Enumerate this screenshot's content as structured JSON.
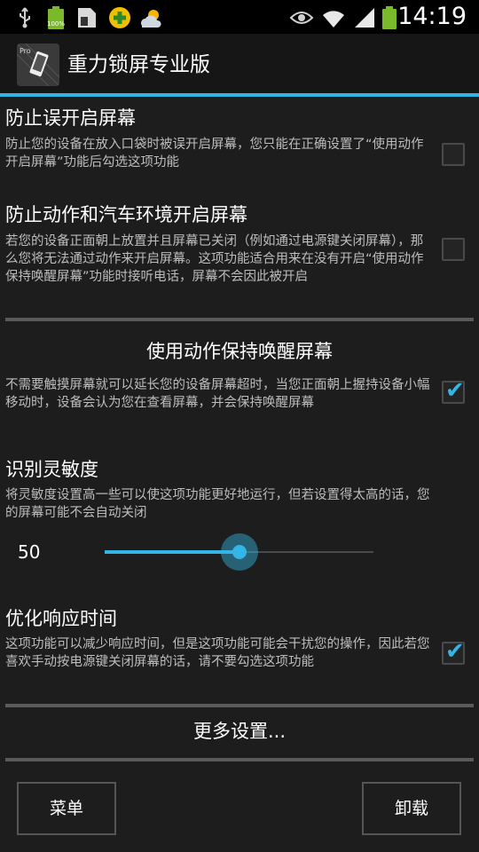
{
  "status_bar": {
    "time": "14:19",
    "battery_label": "100%",
    "icons": [
      "usb-icon",
      "battery-full-icon",
      "sd-card-icon",
      "app-plus-icon",
      "weather-icon",
      "eye-icon",
      "wifi-icon",
      "signal-icon",
      "battery-icon"
    ]
  },
  "action_bar": {
    "title": "重力锁屏专业版",
    "app_icon_text": "Pro",
    "accent_color": "#33b5e5"
  },
  "prefs": {
    "pocket": {
      "title": "防止误开启屏幕",
      "summary": "防止您的设备在放入口袋时被误开启屏幕，您只能在正确设置了“使用动作开启屏幕”功能后勾选这项功能",
      "checked": false
    },
    "face_down": {
      "title": "防止动作和汽车环境开启屏幕",
      "summary": "若您的设备正面朝上放置并且屏幕已关闭（例如通过电源键关闭屏幕），那么您将无法通过动作来开启屏幕。这项功能适合用来在没有开启“使用动作保持唤醒屏幕”功能时接听电话，屏幕不会因此被开启",
      "checked": false
    }
  },
  "keep_awake": {
    "section_title": "使用动作保持唤醒屏幕",
    "summary": "不需要触摸屏幕就可以延长您的设备屏幕超时，当您正面朝上握持设备小幅移动时，设备会认为您在查看屏幕，并会保持唤醒屏幕",
    "checked": true
  },
  "sensitivity": {
    "title": "识别灵敏度",
    "summary": "将灵敏度设置高一些可以使这项功能更好地运行，但若设置得太高的话，您的屏幕可能不会自动关闭",
    "value": "50",
    "fraction": 0.5
  },
  "response": {
    "title": "优化响应时间",
    "summary": "这项功能可以减少响应时间，但是这项功能可能会干扰您的操作，因此若您喜欢手动按电源键关闭屏幕的话，请不要勾选这项功能",
    "checked": true
  },
  "more_settings": "更多设置...",
  "buttons": {
    "menu": "菜单",
    "uninstall": "卸载"
  }
}
